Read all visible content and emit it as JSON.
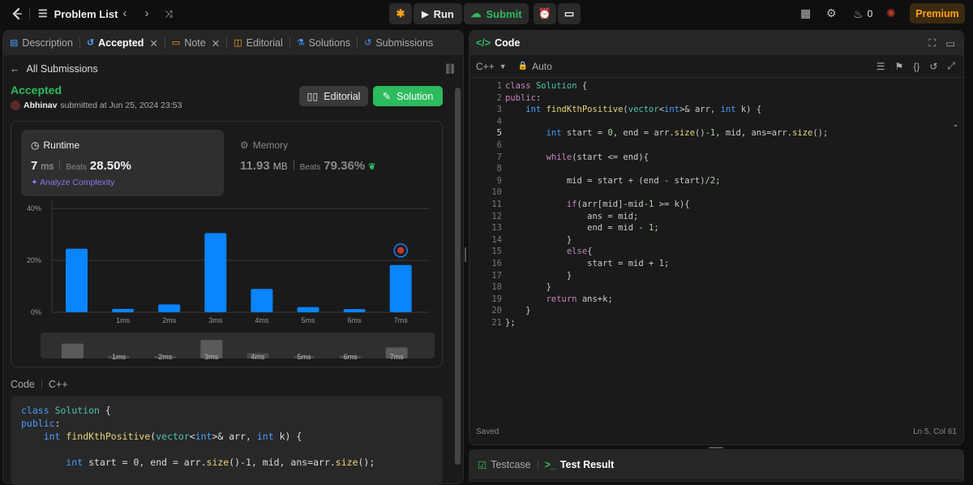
{
  "topbar": {
    "problem_list": "Problem List",
    "run": "Run",
    "submit": "Submit",
    "streak": "0",
    "premium": "Premium"
  },
  "left_tabs": [
    "Description",
    "Accepted",
    "Note",
    "Editorial",
    "Solutions",
    "Submissions"
  ],
  "submission": {
    "back_label": "All Submissions",
    "status": "Accepted",
    "author": "Abhinav",
    "submitted_text": "submitted at Jun 25, 2024 23:53",
    "editorial_btn": "Editorial",
    "solution_btn": "Solution"
  },
  "runtime": {
    "title": "Runtime",
    "value": "7",
    "unit": "ms",
    "beats_label": "Beats",
    "beats": "28.50%",
    "analyze": "Analyze Complexity"
  },
  "memory": {
    "title": "Memory",
    "value": "11.93",
    "unit": "MB",
    "beats_label": "Beats",
    "beats": "79.36%"
  },
  "chart_data": {
    "type": "bar",
    "y_ticks": [
      "40%",
      "20%",
      "0%"
    ],
    "ylim": [
      0,
      40
    ],
    "x_tick_labels": [
      "",
      "1ms",
      "2ms",
      "3ms",
      "4ms",
      "5ms",
      "6ms",
      "7ms"
    ],
    "values": [
      24.5,
      1.3,
      3.0,
      30.5,
      9.0,
      2.0,
      1.2,
      18.2
    ],
    "highlight_index": 7,
    "nav_labels": [
      "1ms",
      "2ms",
      "3ms",
      "4ms",
      "5ms",
      "6ms",
      "7ms"
    ]
  },
  "code_section": {
    "label": "Code",
    "lang": "C++",
    "preview": [
      "class Solution {",
      "public:",
      "    int findKthPositive(vector<int>& arr, int k) {",
      "",
      "        int start = 0, end = arr.size()-1, mid, ans=arr.size();"
    ]
  },
  "editor": {
    "title": "Code",
    "lang": "C++",
    "mode": "Auto",
    "saved": "Saved",
    "cursor": "Ln 5, Col 61",
    "current_line": 5,
    "lines": [
      "class Solution {",
      "public:",
      "    int findKthPositive(vector<int>& arr, int k) {",
      "",
      "        int start = 0, end = arr.size()-1, mid, ans=arr.size();",
      "",
      "        while(start <= end){",
      "",
      "            mid = start + (end - start)/2;",
      "",
      "            if(arr[mid]-mid-1 >= k){",
      "                ans = mid;",
      "                end = mid - 1;",
      "            }",
      "            else{",
      "                start = mid + 1;",
      "            }",
      "        }",
      "        return ans+k;",
      "    }",
      "};"
    ]
  },
  "bottom_tabs": {
    "testcase": "Testcase",
    "result": "Test Result"
  }
}
